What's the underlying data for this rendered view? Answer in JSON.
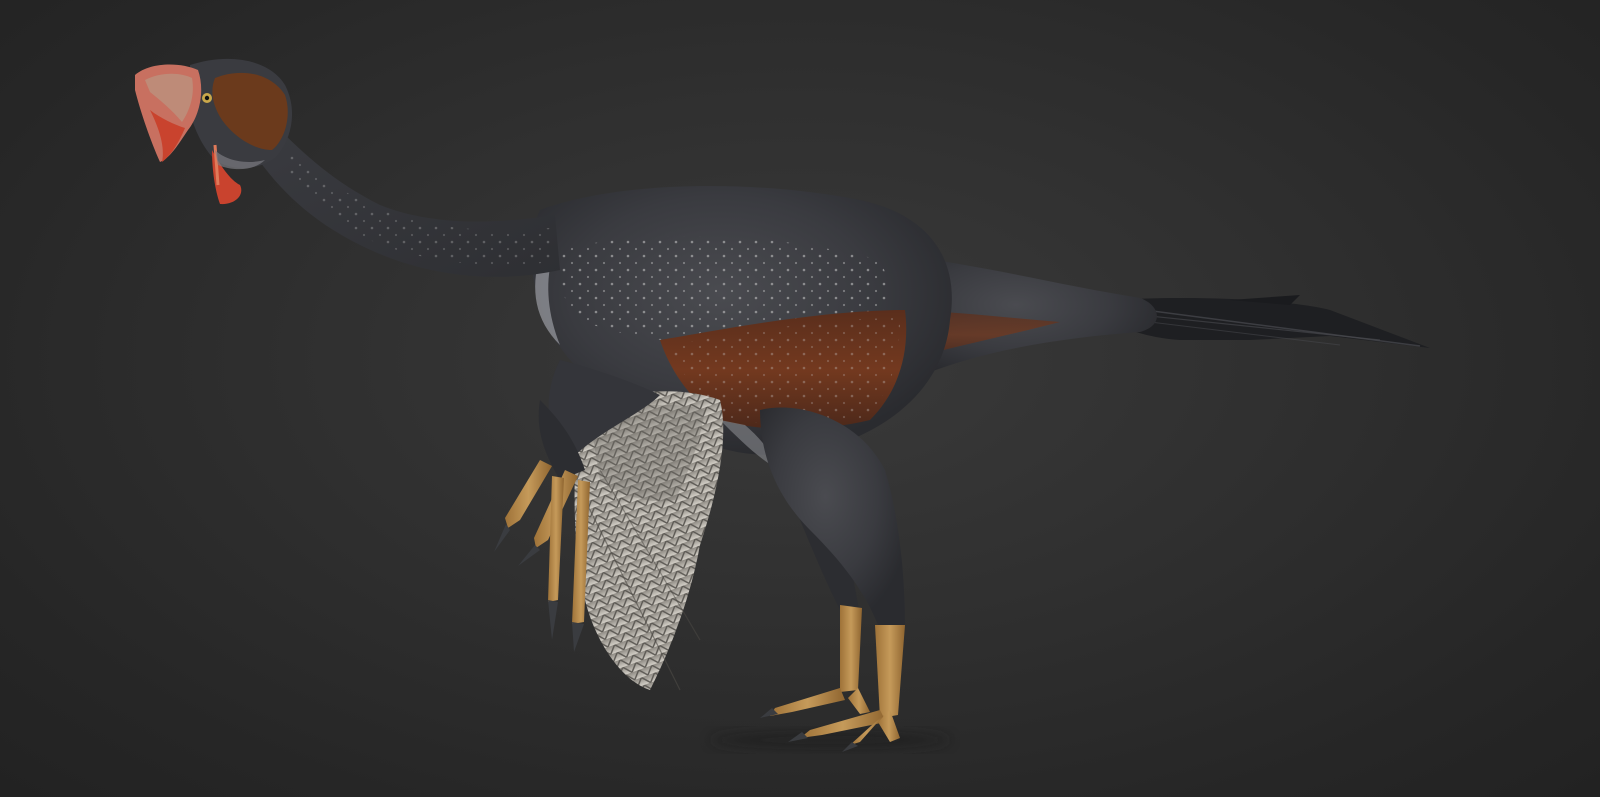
{
  "scene": {
    "subject": "feathered-oviraptorosaur-render",
    "palette": {
      "background": "#2b2b2b",
      "body": "#3e3f44",
      "body_dark": "#2c2d31",
      "rust_band": "#6b3520",
      "crest": "#c87060",
      "beak_red": "#c9432e",
      "face_patch": "#6b3a1c",
      "legs": "#b98a4c",
      "claws": "#3a3c40",
      "wing_feathers": "#b9b5ad",
      "tail_feathers": "#1e1f22"
    }
  }
}
